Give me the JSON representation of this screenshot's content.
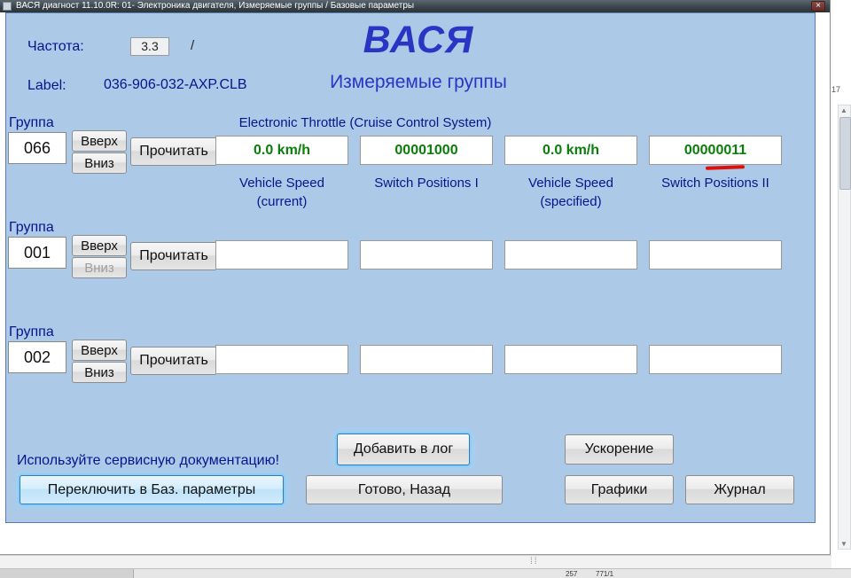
{
  "titlebar": {
    "title": "ВАСЯ диагност 11.10.0R: 01- Электроника двигателя,  Измеряемые группы / Базовые параметры",
    "close": "×"
  },
  "dialog": {
    "freq_label": "Частота:",
    "freq_value": "3.3",
    "freq_sep": "/",
    "brand": "ВАСЯ",
    "label_key": "Label:",
    "label_value": "036-906-032-AXP.CLB",
    "subtitle": "Измеряемые группы",
    "groups": [
      {
        "caption": "Группа",
        "number": "066",
        "up": "Вверх",
        "down": "Вниз",
        "read": "Прочитать",
        "section_title": "Electronic Throttle (Cruise Control System)",
        "values": [
          "0.0 km/h",
          "00001000",
          "0.0 km/h",
          "00000011"
        ],
        "labels": [
          {
            "line1": "Vehicle Speed",
            "line2": "(current)"
          },
          {
            "line1": "Switch Positions I",
            "line2": ""
          },
          {
            "line1": "Vehicle Speed",
            "line2": "(specified)"
          },
          {
            "line1": "Switch Positions II",
            "line2": ""
          }
        ]
      },
      {
        "caption": "Группа",
        "number": "001",
        "up": "Вверх",
        "down": "Вниз",
        "read": "Прочитать",
        "values": [
          "",
          "",
          "",
          ""
        ]
      },
      {
        "caption": "Группа",
        "number": "002",
        "up": "Вверх",
        "down": "Вниз",
        "read": "Прочитать",
        "values": [
          "",
          "",
          "",
          ""
        ]
      }
    ]
  },
  "footer": {
    "notice": "Используйте сервисную документацию!",
    "buttons": {
      "add_log": "Добавить в лог",
      "accel": "Ускорение",
      "switch_basic": "Переключить в Баз. параметры",
      "done_back": "Готово, Назад",
      "graphs": "Графики",
      "journal": "Журнал"
    }
  },
  "background": {
    "ruler_fragment": "17",
    "status_fragments": [
      "257",
      "771/1"
    ],
    "scroll_up_glyph": "▲",
    "scroll_down_glyph": "▼",
    "splitter_dots": "⁞⁞"
  },
  "colors": {
    "dialog_bg": "#adc9e8",
    "navy_text": "#06158c",
    "brand_blue": "#2a35c4",
    "value_green": "#0a7d0a",
    "annotation_red": "#e01008"
  }
}
